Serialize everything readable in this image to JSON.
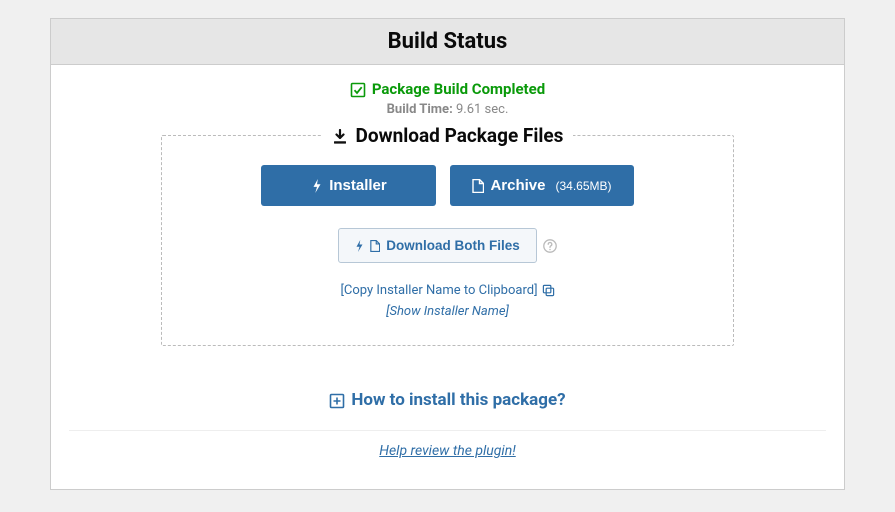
{
  "panel": {
    "title": "Build Status",
    "status": "Package Build Completed",
    "build_time_label": "Build Time:",
    "build_time_value": "9.61 sec."
  },
  "download": {
    "heading": "Download Package Files",
    "installer_label": "Installer",
    "archive_label": "Archive",
    "archive_size": "(34.65MB)",
    "both_label": "Download Both Files",
    "copy_name_label": "[Copy Installer Name to Clipboard]",
    "show_name_label": "[Show Installer Name]"
  },
  "howto": {
    "label": "How to install this package?"
  },
  "footer": {
    "review_link": "Help review the plugin!"
  }
}
